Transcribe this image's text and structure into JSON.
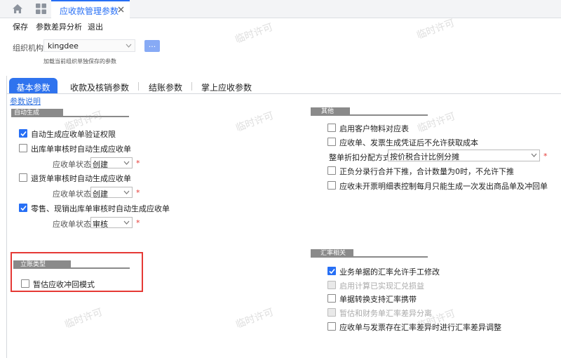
{
  "tabbar": {
    "doc_tab_label": "应收款管理参数"
  },
  "toolbar": {
    "save": "保存",
    "diff": "参数差异分析",
    "exit": "退出"
  },
  "org": {
    "label": "组织机构",
    "value": "kingdee",
    "more_button": "...",
    "hint": "加载当前组织单独保存的参数"
  },
  "tabs": [
    "基本参数",
    "收款及核销参数",
    "结账参数",
    "掌上应收参数"
  ],
  "help_link": "参数说明",
  "left": {
    "auto_group": "自动生成",
    "auto_verify": "自动生成应收单验证权限",
    "outbound": "出库单审核时自动生成应收单",
    "return": "退货单审核时自动生成应收单",
    "retail": "零售、现销出库单审核时自动生成应收单",
    "status_label": "应收单状态",
    "status_1": "创建",
    "status_2": "创建",
    "status_3": "审核",
    "acct_group": "立账类型",
    "estimate": "暂估应收冲回模式",
    "required_mark": "*"
  },
  "right": {
    "other_group": "其他",
    "customer_material": "启用客户物料对应表",
    "voucher": "应收单、发票生成凭证后不允许获取成本",
    "discount_label": "整单折扣分配方式",
    "discount_value": "按价税合计比例分摊",
    "negative": "正负分录行合并下推，合计数量为0时，不允许下推",
    "invoice_once": "应收未开票明细表控制每月只能生成一次发出商品单及冲回单",
    "rate_group": "汇率相关",
    "rate_edit": "业务单据的汇率允许手工修改",
    "rate_calc": "启用计算已实现汇兑损益",
    "rate_carry": "单据转换支持汇率携带",
    "rate_diff": "暂估和财务单汇率差异分离",
    "rate_adjust": "应收单与发票存在汇率差异时进行汇率差异调整"
  },
  "watermark": "临时许可"
}
